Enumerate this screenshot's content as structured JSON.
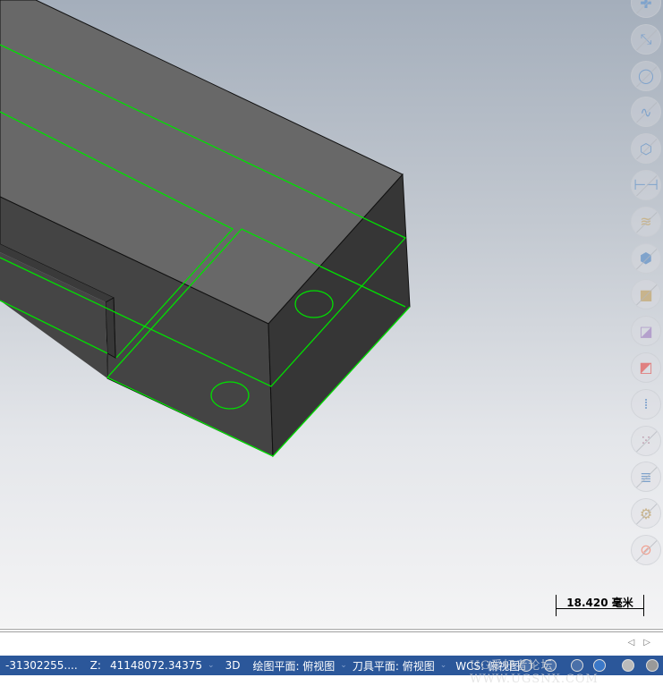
{
  "viewport": {
    "scale_label": "18.420 毫米",
    "geometry_color": "#00e000",
    "toolbar_icons": [
      "point-icon",
      "line-endpoints-icon",
      "circle-icon",
      "spline-icon",
      "wireframe-cube-icon",
      "dimension-icon",
      "surface-icon",
      "solid-cube-icon",
      "solid-block-icon",
      "color-swap-icon",
      "color-swap-red-icon",
      "attribute-icon",
      "color-palette-icon",
      "layers-icon",
      "settings-gear-icon",
      "no-entry-icon"
    ]
  },
  "status": {
    "x_value": "-31302255....",
    "z_label": "Z:",
    "z_value": "41148072.34375",
    "mode": "3D",
    "cplane": "绘图平面: 俯视图",
    "tplane": "刀具平面: 俯视图",
    "wcs": "WCS: 俯视图",
    "watermark": "UG爱好者论坛 WWW.UGSNX.COM",
    "bg_color": "#2b579a"
  }
}
